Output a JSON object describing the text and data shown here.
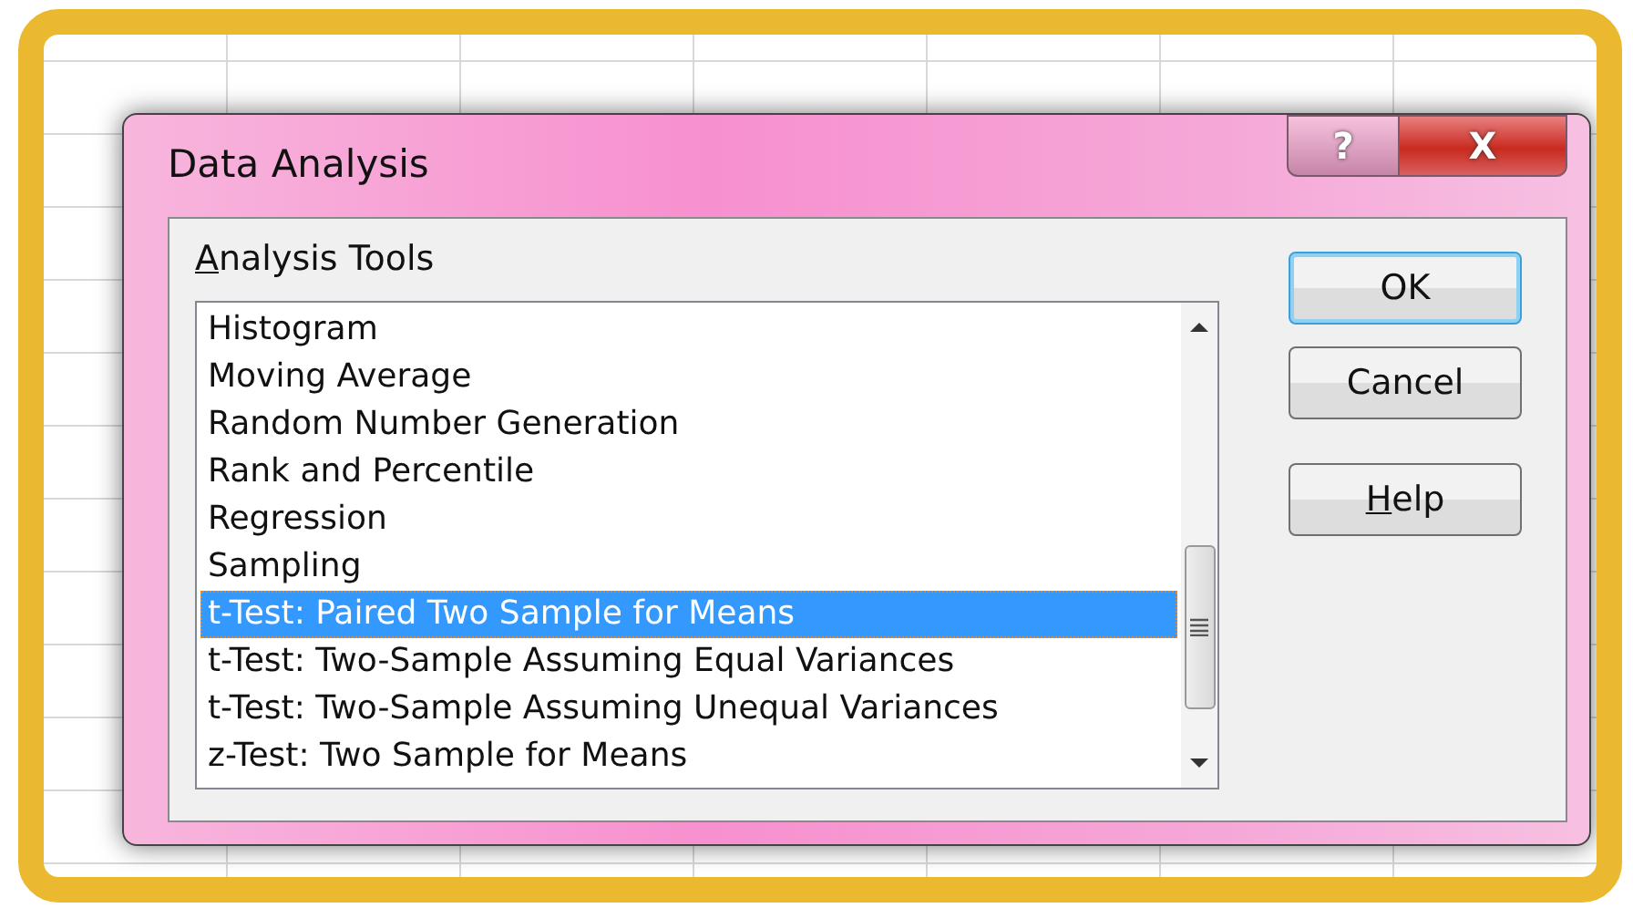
{
  "window": {
    "title": "Data Analysis"
  },
  "title_buttons": [
    {
      "kind": "help",
      "label": "?"
    },
    {
      "kind": "close",
      "label": "X"
    }
  ],
  "list_label": {
    "text": "Analysis Tools",
    "underline_first": true
  },
  "tools": [
    {
      "label": "Histogram",
      "selected": false
    },
    {
      "label": "Moving Average",
      "selected": false
    },
    {
      "label": "Random Number Generation",
      "selected": false
    },
    {
      "label": "Rank and Percentile",
      "selected": false
    },
    {
      "label": "Regression",
      "selected": false
    },
    {
      "label": "Sampling",
      "selected": false
    },
    {
      "label": "t-Test: Paired Two Sample for Means",
      "selected": true
    },
    {
      "label": "t-Test: Two-Sample Assuming Equal Variances",
      "selected": false
    },
    {
      "label": "t-Test: Two-Sample Assuming Unequal Variances",
      "selected": false
    },
    {
      "label": "z-Test: Two Sample for Means",
      "selected": false
    }
  ],
  "buttons": [
    {
      "label": "OK",
      "default": true,
      "underline_first": false
    },
    {
      "label": "Cancel",
      "default": false,
      "underline_first": false
    },
    {
      "label": "Help",
      "default": false,
      "underline_first": true
    }
  ]
}
